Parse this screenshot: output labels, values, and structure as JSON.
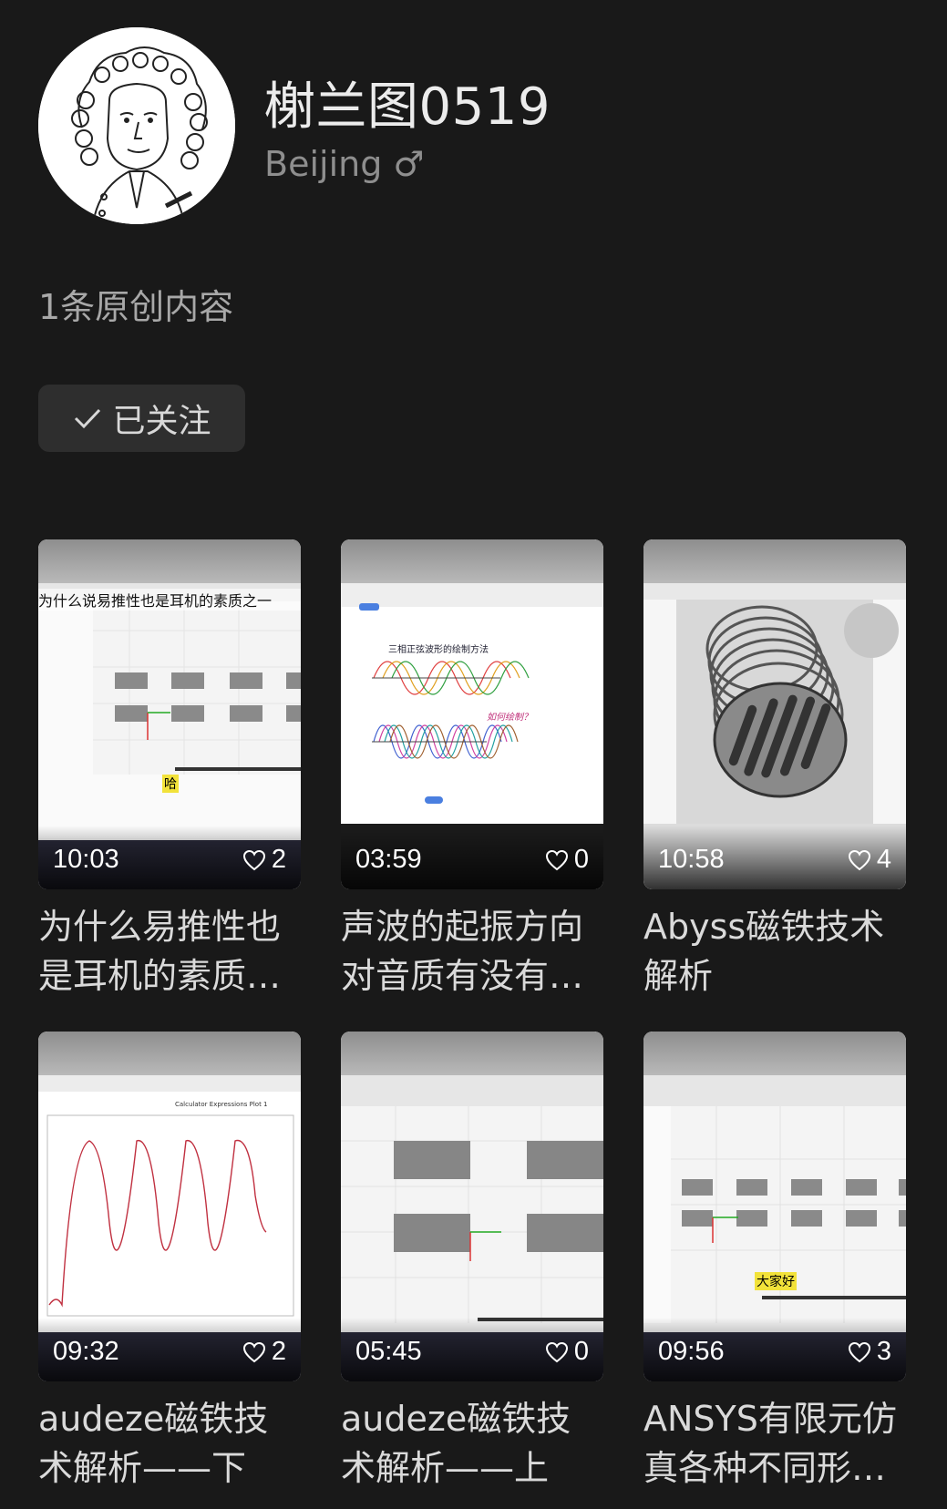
{
  "profile": {
    "name": "榭兰图0519",
    "location": "Beijing",
    "gender_symbol": "♂",
    "original_count_text": "1条原创内容",
    "follow_label": "已关注"
  },
  "videos": [
    {
      "duration": "10:03",
      "likes": "2",
      "title": "为什么易推性也是耳机的素质…",
      "overlay_text": "为什么说易推性也是耳机的素质之一",
      "subtitle": "哈"
    },
    {
      "duration": "03:59",
      "likes": "0",
      "title": "声波的起振方向对音质有没有…",
      "overlay_text": "三相正弦波形的绘制方法",
      "subtitle": "如何绘制？"
    },
    {
      "duration": "10:58",
      "likes": "4",
      "title": "Abyss磁铁技术解析"
    },
    {
      "duration": "09:32",
      "likes": "2",
      "title": "audeze磁铁技术解析——下",
      "overlay_text": "Calculator Expressions Plot 1"
    },
    {
      "duration": "05:45",
      "likes": "0",
      "title": "audeze磁铁技术解析——上"
    },
    {
      "duration": "09:56",
      "likes": "3",
      "title": "ANSYS有限元仿真各种不同形…",
      "subtitle": "大家好"
    }
  ]
}
